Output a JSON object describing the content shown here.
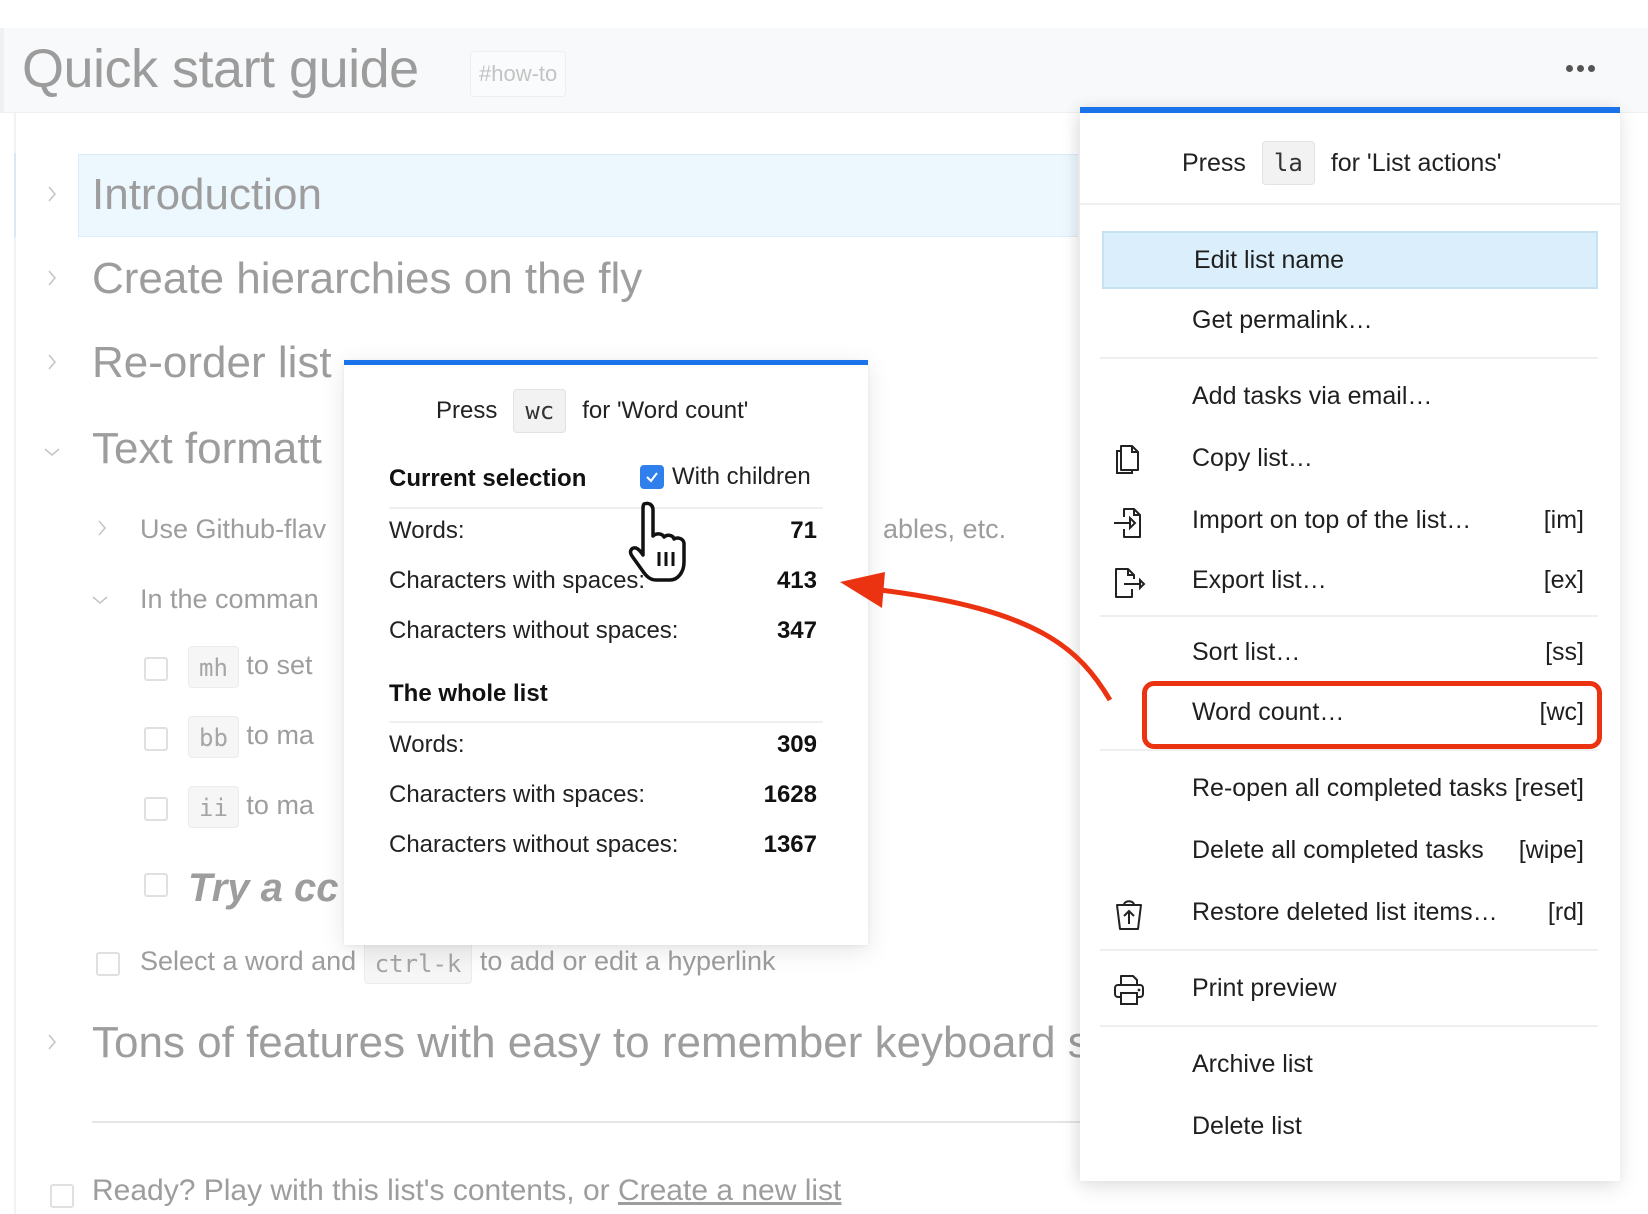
{
  "page": {
    "title": "Quick start guide",
    "tag": "#how-to",
    "more_icon": "ellipsis-icon"
  },
  "list": {
    "items": [
      {
        "label": "Introduction",
        "state": "collapsed",
        "selected": true
      },
      {
        "label": "Create hierarchies on the fly",
        "state": "collapsed"
      },
      {
        "label": "Re-order list",
        "state": "collapsed"
      },
      {
        "label": "Text formatt",
        "state": "expanded"
      }
    ],
    "sub": {
      "github": "Use Github-flav",
      "github_tail": "ables, etc.",
      "command": "In the comman",
      "tasks": [
        {
          "key": "mh",
          "text": "to set"
        },
        {
          "key": "bb",
          "text": "to ma"
        },
        {
          "key": "ii",
          "text": "to ma"
        }
      ],
      "try": "Try a cc",
      "hyperlink_pre": "Select a word and",
      "hyperlink_key": "ctrl-k",
      "hyperlink_post": "to add or edit a hyperlink"
    },
    "tons": "Tons of features with easy to remember keyboard s",
    "ready_text": "Ready? Play with this list's contents, or ",
    "ready_link": "Create a new list"
  },
  "word_count": {
    "press": "Press",
    "key": "wc",
    "for": "for 'Word count'",
    "current": {
      "heading": "Current selection",
      "with_children_label": "With children",
      "with_children_checked": true,
      "rows": [
        {
          "label": "Words:",
          "value": "71"
        },
        {
          "label": "Characters with spaces:",
          "value": "413"
        },
        {
          "label": "Characters without spaces:",
          "value": "347"
        }
      ]
    },
    "whole": {
      "heading": "The whole list",
      "rows": [
        {
          "label": "Words:",
          "value": "309"
        },
        {
          "label": "Characters with spaces:",
          "value": "1628"
        },
        {
          "label": "Characters without spaces:",
          "value": "1367"
        }
      ]
    }
  },
  "menu": {
    "press": "Press",
    "key": "la",
    "for": "for 'List actions'",
    "items": [
      {
        "label": "Edit list name",
        "shortcut": "",
        "icon": "",
        "active": true
      },
      {
        "label": "Get permalink…",
        "shortcut": "",
        "icon": ""
      },
      {
        "label": "Add tasks via email…",
        "shortcut": "",
        "icon": ""
      },
      {
        "label": "Copy list…",
        "shortcut": "",
        "icon": "copy-icon"
      },
      {
        "label": "Import on top of the list…",
        "shortcut": "[im]",
        "icon": "import-icon"
      },
      {
        "label": "Export list…",
        "shortcut": "[ex]",
        "icon": "export-icon"
      },
      {
        "label": "Sort list…",
        "shortcut": "[ss]",
        "icon": ""
      },
      {
        "label": "Word count…",
        "shortcut": "[wc]",
        "icon": "",
        "highlighted": true
      },
      {
        "label": "Re-open all completed tasks",
        "shortcut": "[reset]",
        "icon": ""
      },
      {
        "label": "Delete all completed tasks",
        "shortcut": "[wipe]",
        "icon": ""
      },
      {
        "label": "Restore deleted list items…",
        "shortcut": "[rd]",
        "icon": "restore-trash-icon"
      },
      {
        "label": "Print preview",
        "shortcut": "",
        "icon": "printer-icon"
      },
      {
        "label": "Archive list",
        "shortcut": "",
        "icon": ""
      },
      {
        "label": "Delete list",
        "shortcut": "",
        "icon": ""
      }
    ]
  },
  "annotation": {
    "highlight_color": "#ec3311",
    "accent_color": "#1a73e8"
  }
}
